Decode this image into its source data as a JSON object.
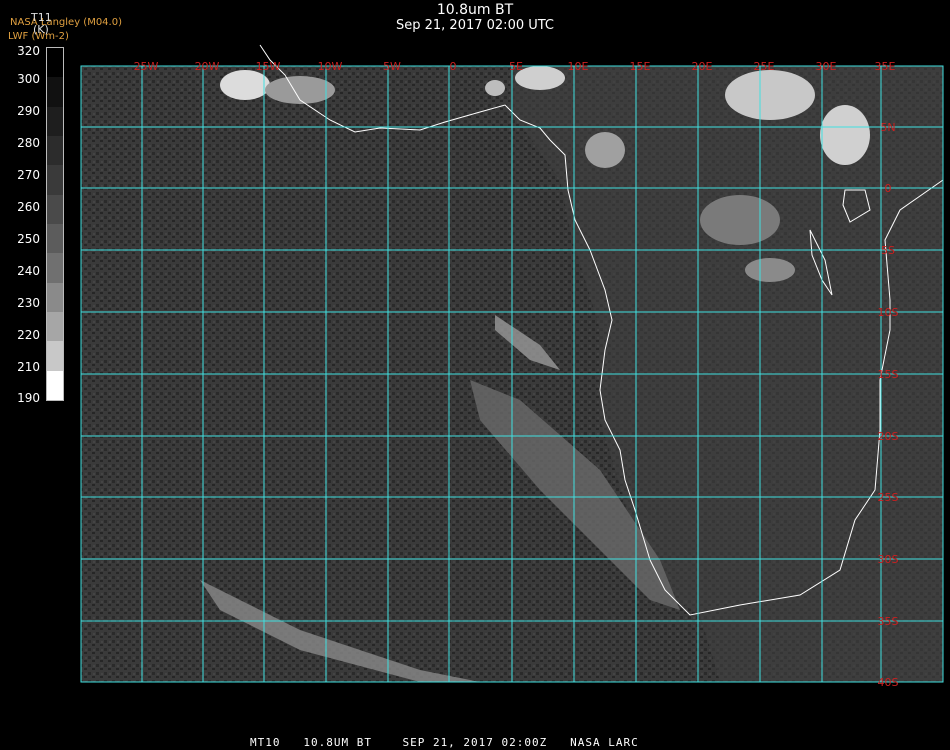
{
  "header": {
    "title": "10.8um BT",
    "subtitle": "Sep 21, 2017 02:00 UTC",
    "org_line1": "NASA Langley (M04.0)",
    "org_line2": "LWF (Wm-2)"
  },
  "colorbar": {
    "variable": "T11",
    "unit": "(K)",
    "ticks": [
      "320",
      "300",
      "290",
      "280",
      "270",
      "260",
      "250",
      "240",
      "230",
      "220",
      "210",
      "190"
    ],
    "colors": [
      "#000000",
      "#111111",
      "#1e1e1e",
      "#2c2c2c",
      "#3a3a3a",
      "#4a4a4a",
      "#5c5c5c",
      "#707070",
      "#8a8a8a",
      "#a6a6a6",
      "#c8c8c8",
      "#ffffff"
    ]
  },
  "map": {
    "lon_labels": [
      "25W",
      "20W",
      "15W",
      "10W",
      "5W",
      "0",
      "5E",
      "10E",
      "15E",
      "20E",
      "25E",
      "30E",
      "35E"
    ],
    "lat_labels": [
      "5N",
      "0",
      "5S",
      "10S",
      "15S",
      "20S",
      "25S",
      "30S",
      "35S",
      "40S"
    ],
    "grid_color": "#40e0e0",
    "label_color": "#cc2020",
    "coast_color": "#ffffff"
  },
  "footer": {
    "text": "MT10   10.8UM BT    SEP 21, 2017 02:00Z   NASA LARC"
  }
}
